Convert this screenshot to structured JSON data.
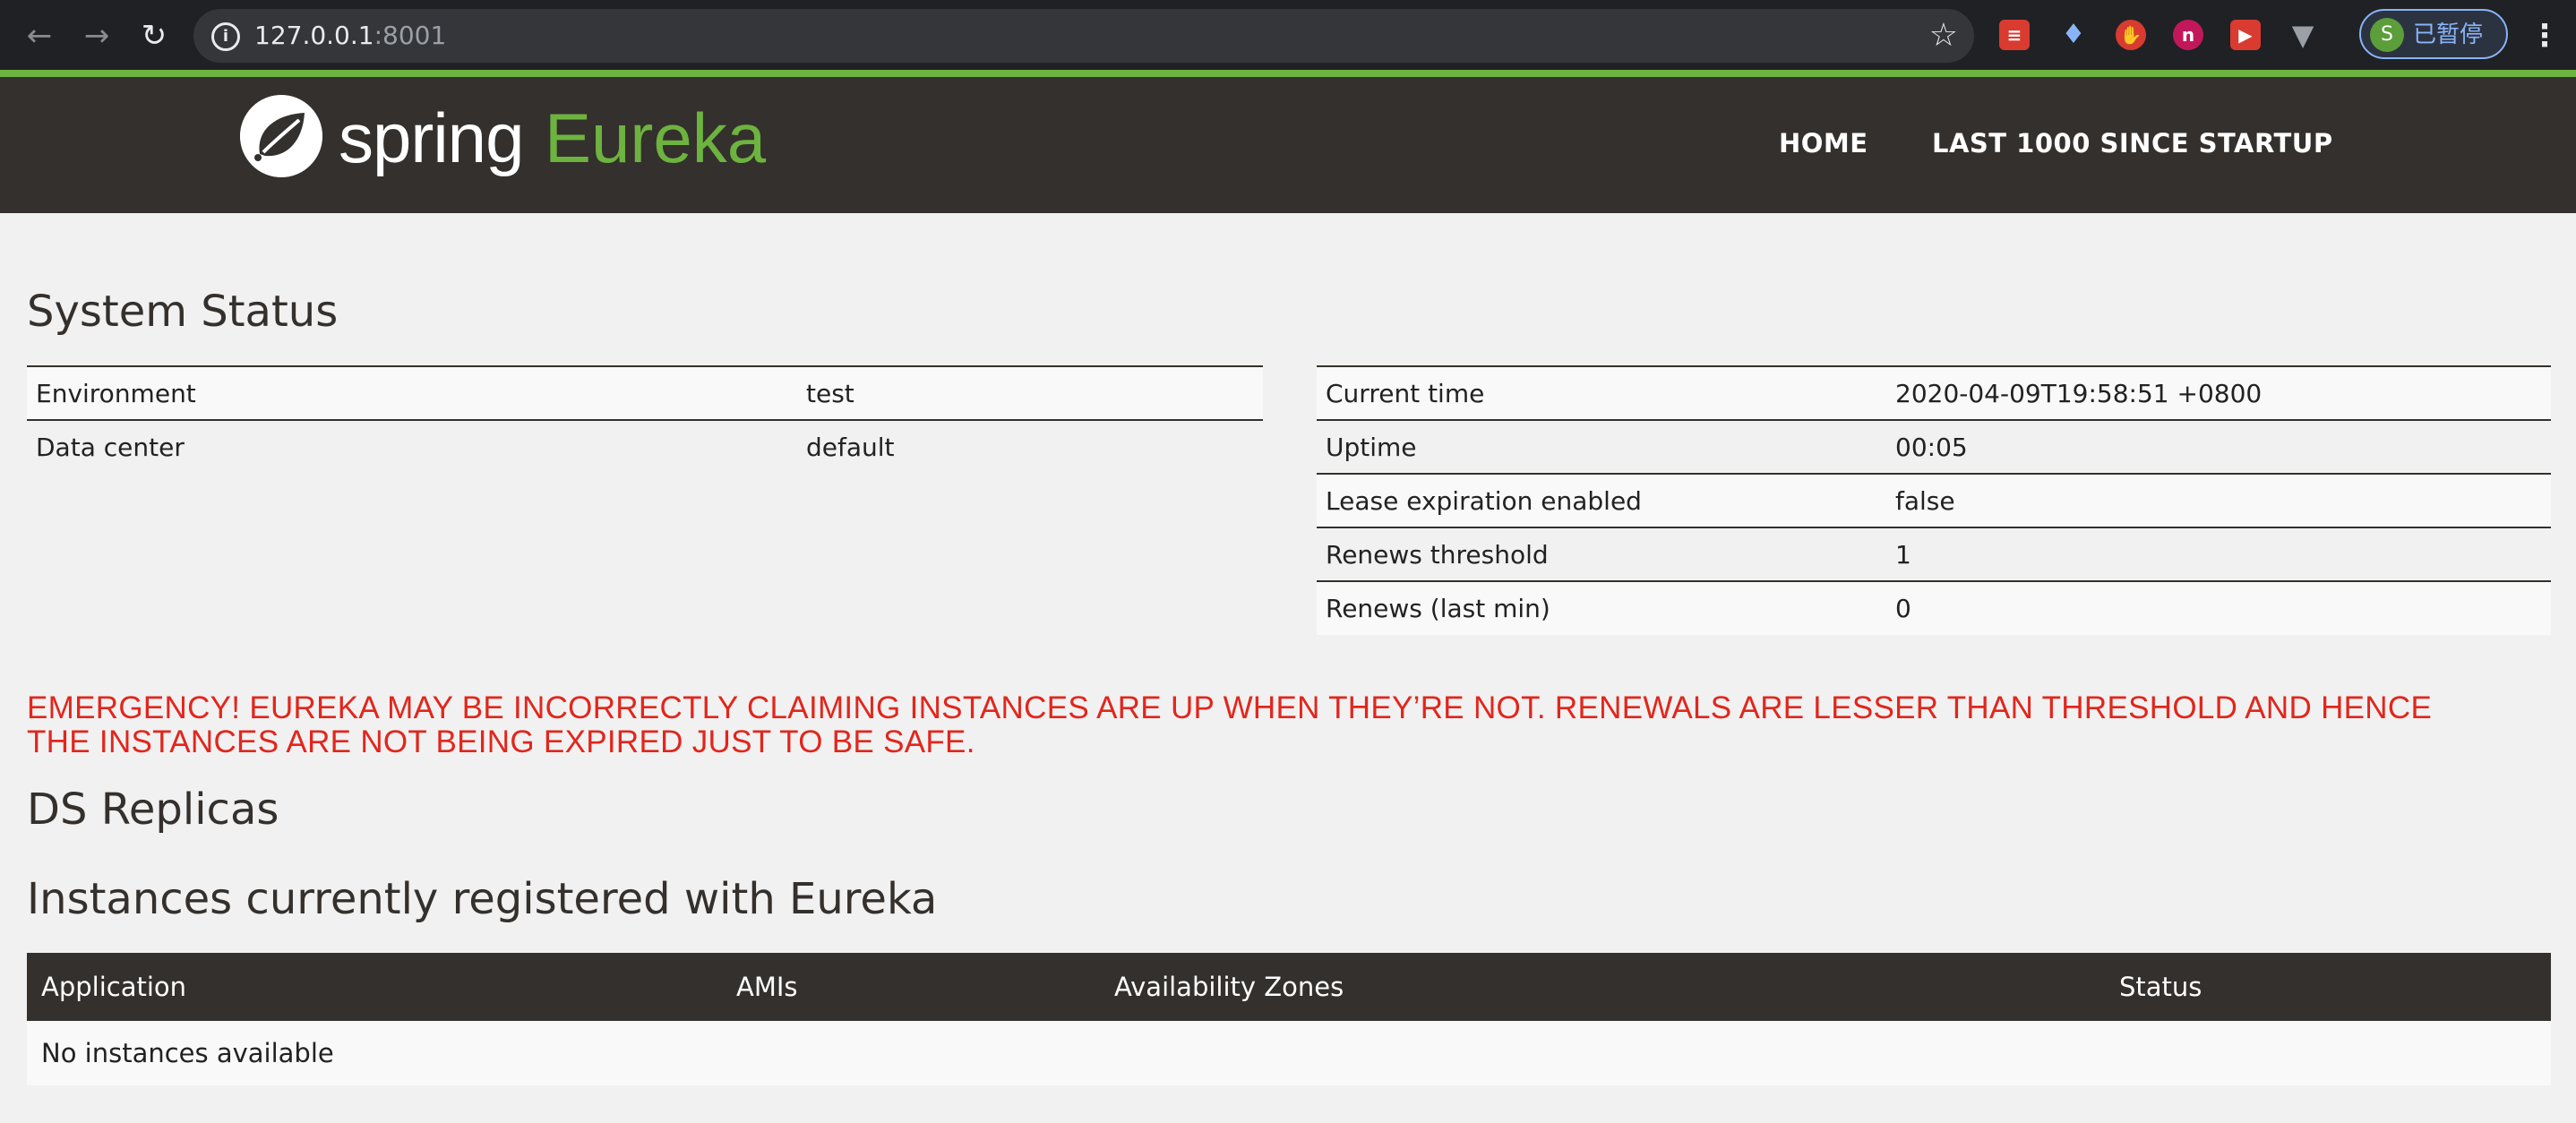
{
  "browser": {
    "url_host": "127.0.0.1",
    "url_port": ":8001",
    "profile_initial": "S",
    "profile_label": "已暂停"
  },
  "header": {
    "logo_spring": "spring",
    "logo_eureka": "Eureka",
    "nav": [
      "HOME",
      "LAST 1000 SINCE STARTUP"
    ]
  },
  "system_status": {
    "title": "System Status",
    "left": [
      {
        "label": "Environment",
        "value": "test"
      },
      {
        "label": "Data center",
        "value": "default"
      }
    ],
    "right": [
      {
        "label": "Current time",
        "value": "2020-04-09T19:58:51 +0800"
      },
      {
        "label": "Uptime",
        "value": "00:05"
      },
      {
        "label": "Lease expiration enabled",
        "value": "false"
      },
      {
        "label": "Renews threshold",
        "value": "1"
      },
      {
        "label": "Renews (last min)",
        "value": "0"
      }
    ]
  },
  "emergency": {
    "line1": "EMERGENCY! EUREKA MAY BE INCORRECTLY CLAIMING INSTANCES ARE UP WHEN THEY’RE NOT. RENEWALS ARE LESSER THAN THRESHOLD AND HENCE",
    "line2": "THE INSTANCES ARE NOT BEING EXPIRED JUST TO BE SAFE."
  },
  "ds_replicas": {
    "title": "DS Replicas"
  },
  "instances": {
    "title": "Instances currently registered with Eureka",
    "columns": [
      "Application",
      "AMIs",
      "Availability Zones",
      "Status"
    ],
    "empty_message": "No instances available"
  },
  "colors": {
    "brand_green": "#6db33f",
    "header_dark": "#34302d",
    "emergency_red": "#e2261c"
  }
}
